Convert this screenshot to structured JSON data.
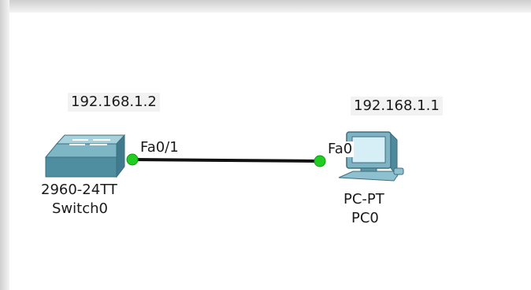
{
  "switch": {
    "ip": "192.168.1.2",
    "model": "2960-24TT",
    "name": "Switch0",
    "port": "Fa0/1"
  },
  "pc": {
    "ip": "192.168.1.1",
    "model": "PC-PT",
    "name": "PC0",
    "port": "Fa0"
  },
  "link": {
    "status": "up",
    "status_color": "#22cc22",
    "cable_color": "#111111"
  },
  "colors": {
    "switch_body": "#5b9bad",
    "pc_body": "#6aa5b8"
  }
}
